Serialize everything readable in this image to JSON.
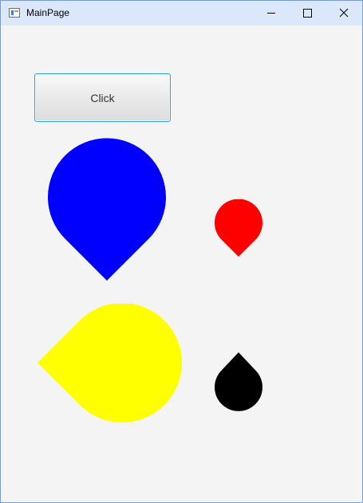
{
  "window": {
    "title": "MainPage",
    "controls": {
      "minimize_icon": "minimize-icon",
      "maximize_icon": "maximize-icon",
      "close_icon": "close-icon"
    }
  },
  "main": {
    "button": {
      "label": "Click"
    },
    "shapes": [
      {
        "name": "blue-teardrop",
        "color": "#0000ff",
        "points_to": "down"
      },
      {
        "name": "red-teardrop",
        "color": "#ff0000",
        "points_to": "down"
      },
      {
        "name": "yellow-teardrop",
        "color": "#ffff00",
        "points_to": "left"
      },
      {
        "name": "black-teardrop",
        "color": "#000000",
        "points_to": "up"
      }
    ]
  }
}
